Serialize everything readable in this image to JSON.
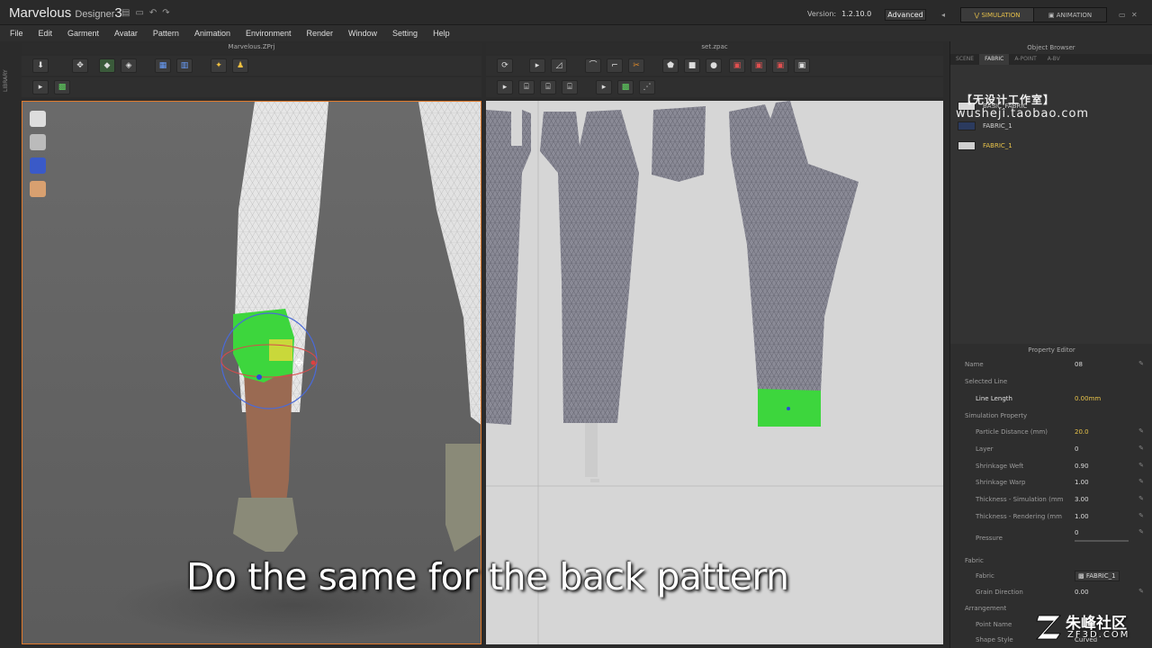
{
  "app": {
    "brand_name": "Marvelous",
    "brand_sub": "Designer",
    "brand_num": "3",
    "version_label": "Version:",
    "version_value": "1.2.10.0",
    "advanced_label": "Advanced",
    "mode_simulation": "SIMULATION",
    "mode_animation": "ANIMATION"
  },
  "menu": [
    "File",
    "Edit",
    "Garment",
    "Avatar",
    "Pattern",
    "Animation",
    "Environment",
    "Render",
    "Window",
    "Setting",
    "Help"
  ],
  "panels": {
    "view3d_title": "Marvelous.ZPrj",
    "view2d_title": "set.zpac",
    "library_label": "LIBRARY",
    "object_browser_title": "Object Browser",
    "property_editor_title": "Property Editor"
  },
  "object_browser": {
    "tabs": [
      "SCENE",
      "FABRIC",
      "A-POINT",
      "A-BV"
    ],
    "active_tab": "FABRIC",
    "fabrics": [
      {
        "name": "BASIC_FABRIC",
        "color": "#d8d8d8"
      },
      {
        "name": "FABRIC_1",
        "color": "#2b3a5e"
      },
      {
        "name": "FABRIC_1",
        "color": "#cfcfcf"
      }
    ],
    "watermark_cn": "【无设计工作室】",
    "watermark_url": "wusheji.taobao.com"
  },
  "property_editor": {
    "rows": [
      {
        "label": "Name",
        "value": "08",
        "section": false,
        "highlight": false
      },
      {
        "label": "Selected Line",
        "value": "",
        "section": true,
        "highlight": false
      },
      {
        "label": "Line Length",
        "value": "0.00mm",
        "section": false,
        "highlight": true
      },
      {
        "label": "Simulation Property",
        "value": "",
        "section": true,
        "highlight": false
      },
      {
        "label": "Particle Distance (mm)",
        "value": "20.0",
        "section": false,
        "highlight": true
      },
      {
        "label": "Layer",
        "value": "0",
        "section": false,
        "highlight": false
      },
      {
        "label": "Shrinkage Weft",
        "value": "0.90",
        "section": false,
        "highlight": false
      },
      {
        "label": "Shrinkage Warp",
        "value": "1.00",
        "section": false,
        "highlight": false
      },
      {
        "label": "Thickness - Simulation (mm",
        "value": "3.00",
        "section": false,
        "highlight": false
      },
      {
        "label": "Thickness - Rendering (mm",
        "value": "1.00",
        "section": false,
        "highlight": false
      },
      {
        "label": "Pressure",
        "value": "0",
        "section": false,
        "highlight": false
      },
      {
        "label": "Fabric",
        "value": "",
        "section": true,
        "highlight": false
      },
      {
        "label": "Fabric",
        "value": "FABRIC_1",
        "section": false,
        "highlight": false
      },
      {
        "label": "Grain Direction",
        "value": "0.00",
        "section": false,
        "highlight": false
      },
      {
        "label": "Arrangement",
        "value": "",
        "section": true,
        "highlight": false
      },
      {
        "label": "Point Name",
        "value": "",
        "section": false,
        "highlight": false
      },
      {
        "label": "Shape Style",
        "value": "Curved",
        "section": false,
        "highlight": false
      }
    ]
  },
  "caption": "Do the same for the back pattern",
  "logo": {
    "cn": "朱峰社区",
    "en": "ZF3D.COM"
  },
  "colors": {
    "selection_green": "#3dd63d",
    "accent_orange": "#e07a2c",
    "highlight_yellow": "#e8c34a"
  }
}
